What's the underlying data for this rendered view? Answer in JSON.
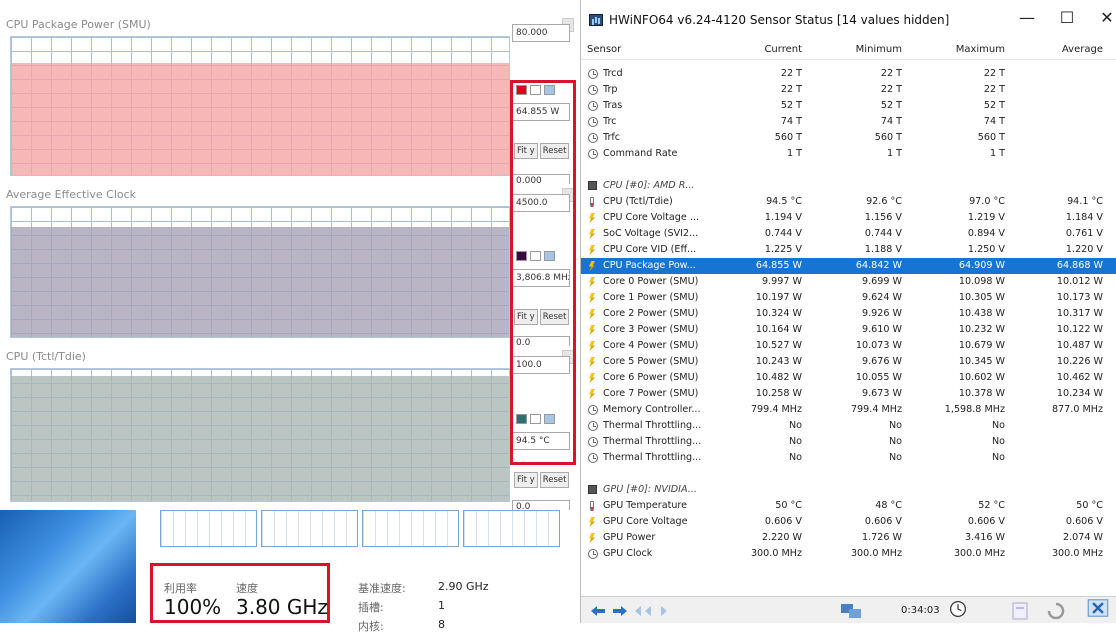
{
  "graphs": [
    {
      "title": "CPU Package Power (SMU)",
      "max": "80.000",
      "current": "64.855 W",
      "min": "0.000",
      "fill_fraction": 0.81,
      "fill_color": "#f4a3a3",
      "swatch": "#e0001b"
    },
    {
      "title": "Average Effective Clock",
      "max": "4500.0",
      "current": "3,806.8 MHz",
      "min": "0.0",
      "fill_fraction": 0.85,
      "fill_color": "#a7a0b5",
      "swatch": "#3b0a3f"
    },
    {
      "title": "CPU (Tctl/Tdie)",
      "max": "100.0",
      "current": "94.5 °C",
      "min": "0.0",
      "fill_fraction": 0.945,
      "fill_color": "#a8b5b0",
      "swatch": "#2f6f6f"
    }
  ],
  "graph_buttons": {
    "fit": "Fit y",
    "reset": "Reset"
  },
  "taskmgr": {
    "util_label": "利用率",
    "util_value": "100%",
    "speed_label": "速度",
    "speed_value": "3.80 GHz",
    "base_label": "基准速度:",
    "base_value": "2.90 GHz",
    "socket_label": "插槽:",
    "socket_value": "1",
    "core_label": "内核:",
    "core_value": "8"
  },
  "window": {
    "title": "HWiNFO64 v6.24-4120 Sensor Status [14 values hidden]",
    "controls": {
      "minimize": "—",
      "maximize": "☐",
      "close": "✕"
    }
  },
  "columns": [
    "Sensor",
    "Current",
    "Minimum",
    "Maximum",
    "Average"
  ],
  "rows": [
    {
      "icon": "clock",
      "name": "Trcd",
      "cur": "22 T",
      "min": "22 T",
      "max": "22 T",
      "avg": ""
    },
    {
      "icon": "clock",
      "name": "Trp",
      "cur": "22 T",
      "min": "22 T",
      "max": "22 T",
      "avg": ""
    },
    {
      "icon": "clock",
      "name": "Tras",
      "cur": "52 T",
      "min": "52 T",
      "max": "52 T",
      "avg": ""
    },
    {
      "icon": "clock",
      "name": "Trc",
      "cur": "74 T",
      "min": "74 T",
      "max": "74 T",
      "avg": ""
    },
    {
      "icon": "clock",
      "name": "Trfc",
      "cur": "560 T",
      "min": "560 T",
      "max": "560 T",
      "avg": ""
    },
    {
      "icon": "clock",
      "name": "Command Rate",
      "cur": "1 T",
      "min": "1 T",
      "max": "1 T",
      "avg": ""
    },
    {
      "icon": "none",
      "name": "",
      "cur": "",
      "min": "",
      "max": "",
      "avg": ""
    },
    {
      "icon": "chip",
      "name": "CPU [#0]: AMD R...",
      "cur": "",
      "min": "",
      "max": "",
      "avg": "",
      "group": true
    },
    {
      "icon": "temp",
      "name": "CPU (Tctl/Tdie)",
      "cur": "94.5 °C",
      "min": "92.6 °C",
      "max": "97.0 °C",
      "avg": "94.1 °C"
    },
    {
      "icon": "volt",
      "name": "CPU Core Voltage ...",
      "cur": "1.194 V",
      "min": "1.156 V",
      "max": "1.219 V",
      "avg": "1.184 V"
    },
    {
      "icon": "volt",
      "name": "SoC Voltage (SVI2...",
      "cur": "0.744 V",
      "min": "0.744 V",
      "max": "0.894 V",
      "avg": "0.761 V"
    },
    {
      "icon": "volt",
      "name": "CPU Core VID (Eff...",
      "cur": "1.225 V",
      "min": "1.188 V",
      "max": "1.250 V",
      "avg": "1.220 V"
    },
    {
      "icon": "volt",
      "name": "CPU Package Pow...",
      "cur": "64.855 W",
      "min": "64.842 W",
      "max": "64.909 W",
      "avg": "64.868 W",
      "selected": true
    },
    {
      "icon": "volt",
      "name": "Core 0 Power (SMU)",
      "cur": "9.997 W",
      "min": "9.699 W",
      "max": "10.098 W",
      "avg": "10.012 W"
    },
    {
      "icon": "volt",
      "name": "Core 1 Power (SMU)",
      "cur": "10.197 W",
      "min": "9.624 W",
      "max": "10.305 W",
      "avg": "10.173 W"
    },
    {
      "icon": "volt",
      "name": "Core 2 Power (SMU)",
      "cur": "10.324 W",
      "min": "9.926 W",
      "max": "10.438 W",
      "avg": "10.317 W"
    },
    {
      "icon": "volt",
      "name": "Core 3 Power (SMU)",
      "cur": "10.164 W",
      "min": "9.610 W",
      "max": "10.232 W",
      "avg": "10.122 W"
    },
    {
      "icon": "volt",
      "name": "Core 4 Power (SMU)",
      "cur": "10.527 W",
      "min": "10.073 W",
      "max": "10.679 W",
      "avg": "10.487 W"
    },
    {
      "icon": "volt",
      "name": "Core 5 Power (SMU)",
      "cur": "10.243 W",
      "min": "9.676 W",
      "max": "10.345 W",
      "avg": "10.226 W"
    },
    {
      "icon": "volt",
      "name": "Core 6 Power (SMU)",
      "cur": "10.482 W",
      "min": "10.055 W",
      "max": "10.602 W",
      "avg": "10.462 W"
    },
    {
      "icon": "volt",
      "name": "Core 7 Power (SMU)",
      "cur": "10.258 W",
      "min": "9.673 W",
      "max": "10.378 W",
      "avg": "10.234 W"
    },
    {
      "icon": "clock",
      "name": "Memory Controller...",
      "cur": "799.4 MHz",
      "min": "799.4 MHz",
      "max": "1,598.8 MHz",
      "avg": "877.0 MHz"
    },
    {
      "icon": "clock",
      "name": "Thermal Throttling...",
      "cur": "No",
      "min": "No",
      "max": "No",
      "avg": ""
    },
    {
      "icon": "clock",
      "name": "Thermal Throttling...",
      "cur": "No",
      "min": "No",
      "max": "No",
      "avg": ""
    },
    {
      "icon": "clock",
      "name": "Thermal Throttling...",
      "cur": "No",
      "min": "No",
      "max": "No",
      "avg": ""
    },
    {
      "icon": "none",
      "name": "",
      "cur": "",
      "min": "",
      "max": "",
      "avg": ""
    },
    {
      "icon": "chip",
      "name": "GPU [#0]: NVIDIA...",
      "cur": "",
      "min": "",
      "max": "",
      "avg": "",
      "group": true
    },
    {
      "icon": "temp",
      "name": "GPU Temperature",
      "cur": "50 °C",
      "min": "48 °C",
      "max": "52 °C",
      "avg": "50 °C"
    },
    {
      "icon": "volt",
      "name": "GPU Core Voltage",
      "cur": "0.606 V",
      "min": "0.606 V",
      "max": "0.606 V",
      "avg": "0.606 V"
    },
    {
      "icon": "volt",
      "name": "GPU Power",
      "cur": "2.220 W",
      "min": "1.726 W",
      "max": "3.416 W",
      "avg": "2.074 W"
    },
    {
      "icon": "clock",
      "name": "GPU Clock",
      "cur": "300.0 MHz",
      "min": "300.0 MHz",
      "max": "300.0 MHz",
      "avg": "300.0 MHz"
    }
  ],
  "statusbar": {
    "elapsed": "0:34:03"
  }
}
